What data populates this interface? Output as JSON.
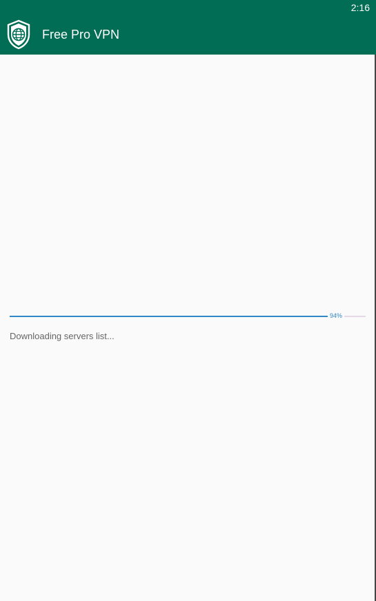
{
  "status_bar": {
    "time": "2:16"
  },
  "app_bar": {
    "title": "Free Pro VPN",
    "logo_icon": "shield-globe-icon"
  },
  "download": {
    "progress_percent": 94,
    "progress_label": "94%",
    "message": "Downloading servers list..."
  },
  "colors": {
    "primary": "#006d54",
    "progress": "#2f87c8",
    "background": "#fafafa"
  }
}
